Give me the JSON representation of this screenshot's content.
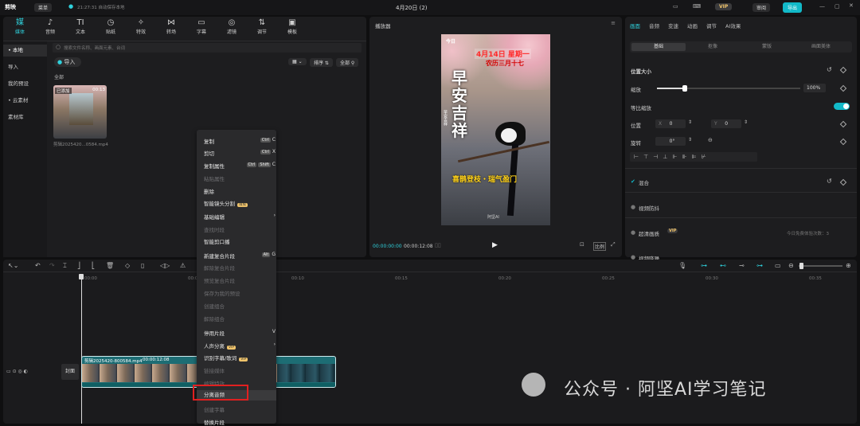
{
  "app": {
    "logo": "剪映",
    "project_btn": "菜单",
    "autosave": "21:27:31 自动保存本地",
    "title": "4月20日 (2)",
    "vip": "VIP",
    "review": "审阅",
    "export": "导出"
  },
  "toolbar": [
    {
      "icon": "媒",
      "label": "媒体"
    },
    {
      "icon": "♪",
      "label": "音频"
    },
    {
      "icon": "TI",
      "label": "文本"
    },
    {
      "icon": "◷",
      "label": "贴纸"
    },
    {
      "icon": "✧",
      "label": "特效"
    },
    {
      "icon": "⋈",
      "label": "转场"
    },
    {
      "icon": "▭",
      "label": "字幕"
    },
    {
      "icon": "◎",
      "label": "滤镜"
    },
    {
      "icon": "⇅",
      "label": "调节"
    },
    {
      "icon": "▣",
      "label": "模板"
    }
  ],
  "sidebar": [
    {
      "label": "• 本地"
    },
    {
      "label": "导入"
    },
    {
      "label": "我的预设"
    },
    {
      "label": "• 云素材"
    },
    {
      "label": "素材库"
    }
  ],
  "media": {
    "search_placeholder": "搜索文件名称、画面元素、台词",
    "import": "导入",
    "sort": "排序",
    "all": "全部",
    "section": "全部",
    "thumb_badge": "已添加",
    "thumb_duration": "00:13",
    "thumb_name": "剪辑2025420...0584.mp4"
  },
  "player": {
    "title": "播放器",
    "time_current": "00:00:00:00",
    "time_total": "00:00:12:08",
    "ratio": "比例",
    "poster": {
      "logo": "今日",
      "date1": "4月14日 星期一",
      "date2": "农历三月十七",
      "big": [
        "早",
        "安",
        "吉",
        "祥"
      ],
      "side": "早安吉祥",
      "slogan": "喜鹊登枝・瑞气盈门",
      "watermark": "阿坚AI"
    }
  },
  "menu": [
    {
      "label": "复制",
      "keys": [
        "Ctrl"
      ],
      "key": "C",
      "dis": false
    },
    {
      "label": "剪切",
      "keys": [
        "Ctrl"
      ],
      "key": "X",
      "dis": false
    },
    {
      "label": "复制属性",
      "keys": [
        "Ctrl",
        "Shift"
      ],
      "key": "C",
      "dis": false
    },
    {
      "label": "粘贴属性",
      "keys": [],
      "key": "",
      "dis": true
    },
    {
      "label": "删除",
      "keys": [],
      "key": "",
      "dis": false
    },
    {
      "label": "智能镜头分割",
      "badge": "限免",
      "keys": [],
      "key": "",
      "dis": false
    },
    {
      "label": "基础编辑",
      "keys": [],
      "key": "›",
      "dis": false
    },
    {
      "label": "查找时段",
      "keys": [],
      "key": "",
      "dis": true
    },
    {
      "label": "智能剪口播",
      "keys": [],
      "key": "",
      "dis": false
    },
    {
      "label": "新建复合片段",
      "keys": [
        "Alt"
      ],
      "key": "G",
      "dis": false
    },
    {
      "label": "解除复合片段",
      "keys": [],
      "key": "",
      "dis": true
    },
    {
      "label": "预览复合片段",
      "keys": [],
      "key": "",
      "dis": true
    },
    {
      "label": "保存为我的预设",
      "keys": [],
      "key": "",
      "dis": true
    },
    {
      "label": "创建组合",
      "keys": [],
      "key": "",
      "dis": true
    },
    {
      "label": "解除组合",
      "keys": [],
      "key": "",
      "dis": true
    },
    {
      "label": "停用片段",
      "keys": [],
      "key": "V",
      "dis": false
    },
    {
      "label": "人声分离",
      "badge": "VIP",
      "keys": [],
      "key": "›",
      "dis": false
    },
    {
      "label": "识别字幕/歌词",
      "badge": "VIP",
      "keys": [],
      "key": "",
      "dis": false
    },
    {
      "label": "链接媒体",
      "keys": [],
      "key": "",
      "dis": true
    },
    {
      "label": "编辑特效",
      "keys": [],
      "key": "",
      "dis": true
    },
    {
      "label": "分离音频",
      "keys": [],
      "key": "",
      "dis": false
    },
    {
      "label": "创建字幕",
      "keys": [],
      "key": "",
      "dis": true
    },
    {
      "label": "替换片段",
      "keys": [],
      "key": "",
      "dis": false
    }
  ],
  "right": {
    "tabs": [
      "画面",
      "音频",
      "变速",
      "动画",
      "调节",
      "AI效果"
    ],
    "segs": [
      "基础",
      "抠像",
      "蒙版",
      "画面美体"
    ],
    "pos_size": "位置大小",
    "scale": "缩放",
    "scale_val": "100%",
    "uniform": "等比缩放",
    "position": "位置",
    "x": "X",
    "x_val": "0",
    "y": "Y",
    "y_val": "0",
    "rotate": "旋转",
    "rot_val": "0°",
    "blend": "混合",
    "stabilize": "视频防抖",
    "enhance": "超清画质",
    "enhance_note": "今日免费体验次数：3",
    "denoise": "视频降噪"
  },
  "timeline": {
    "ticks": [
      "00:00",
      "00:05",
      "00:10",
      "00:15",
      "00:20",
      "00:25",
      "00:30",
      "00:35"
    ],
    "cover": "封面",
    "clip_name": "剪辑2025420-800584.mp4",
    "clip_dur": "00:00:12:08"
  },
  "watermark": "公众号 · 阿坚AI学习笔记"
}
